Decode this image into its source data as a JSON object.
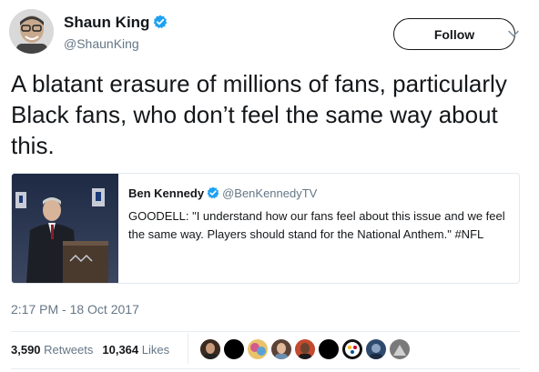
{
  "tweet": {
    "author": {
      "name": "Shaun King",
      "handle": "@ShaunKing",
      "avatar_icon": "author-avatar-photo",
      "verified_icon": "verified-badge-icon"
    },
    "follow_label": "Follow",
    "text": "A blatant erasure of millions of fans, particularly Black fans, who don’t feel the same way about this.",
    "timestamp": "2:17 PM - 18 Oct 2017",
    "stats": {
      "retweets_count": "3,590",
      "retweets_label": "Retweets",
      "likes_count": "10,364",
      "likes_label": "Likes"
    },
    "likers": [
      {
        "icon": "liker-avatar-woman"
      },
      {
        "icon": "liker-avatar-black"
      },
      {
        "icon": "liker-avatar-colorful"
      },
      {
        "icon": "liker-avatar-woman-2"
      },
      {
        "icon": "liker-avatar-man"
      },
      {
        "icon": "liker-avatar-black-2"
      },
      {
        "icon": "liker-avatar-steelers-logo"
      },
      {
        "icon": "liker-avatar-blue"
      },
      {
        "icon": "liker-avatar-gray"
      }
    ]
  },
  "quoted_tweet": {
    "author_name": "Ben Kennedy",
    "handle": "@BenKennedyTV",
    "text": "GOODELL: \"I understand how our fans feel about this issue and we feel the same way. Players should stand for the National Anthem.\" #NFL",
    "image_icon": "press-conference-photo"
  },
  "colors": {
    "text_primary": "#14171a",
    "text_secondary": "#657786",
    "verified_blue": "#1da1f2",
    "border": "#e1e8ed"
  }
}
